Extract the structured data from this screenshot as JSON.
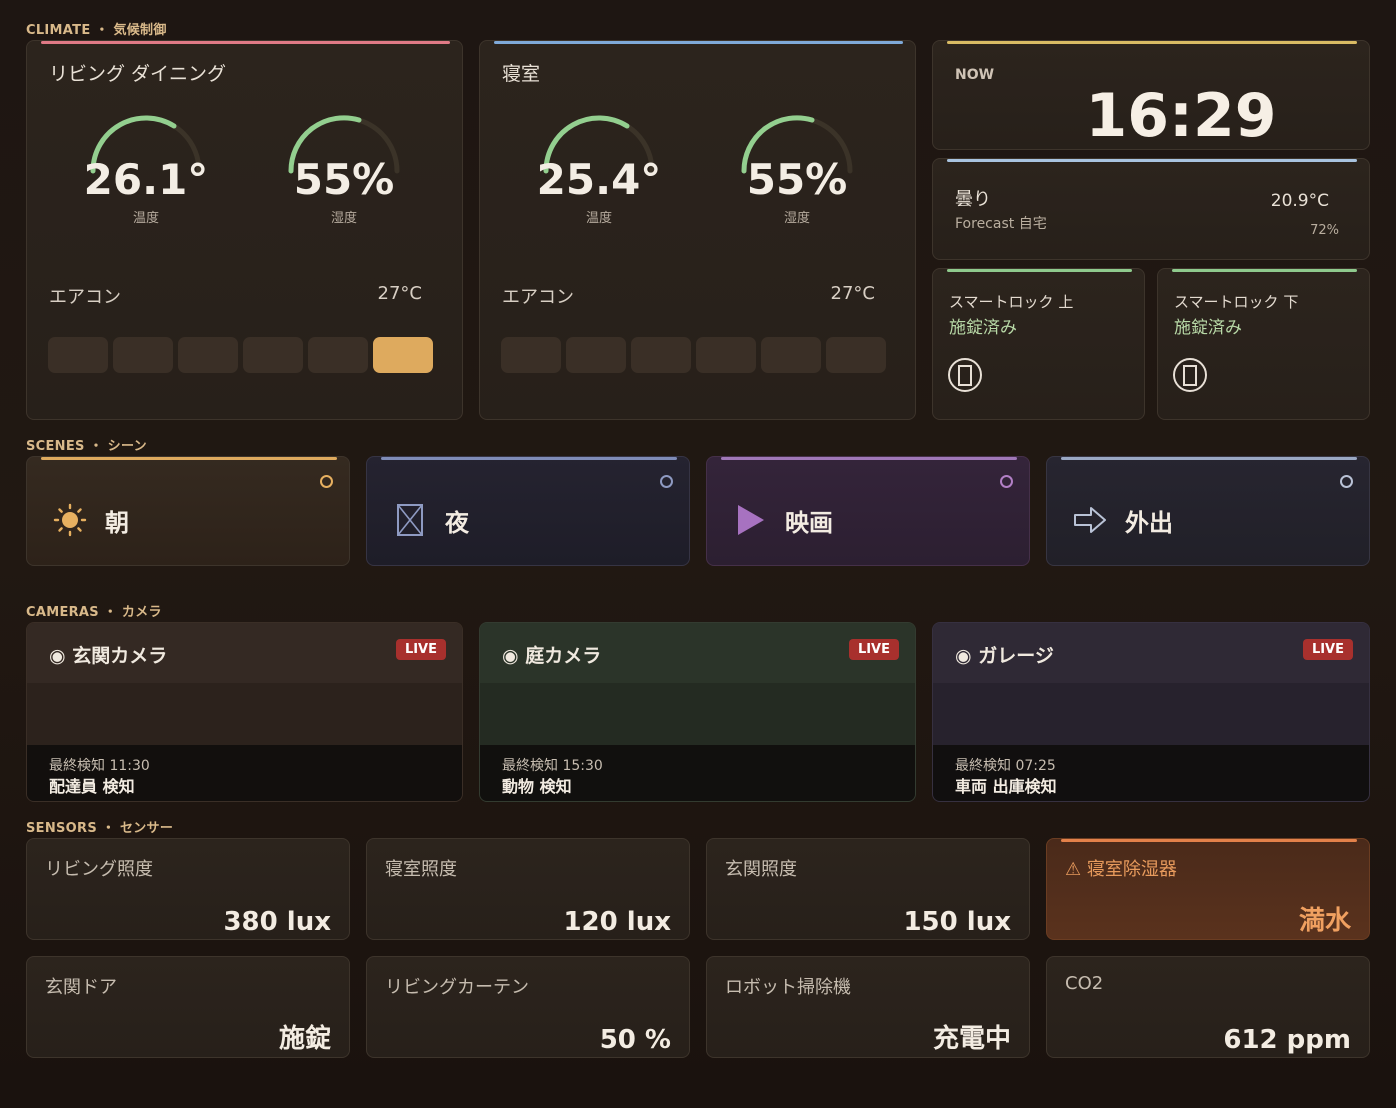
{
  "sections": {
    "climate": "CLIMATE ・ 気候制御",
    "scenes": "SCENES ・ シーン",
    "cameras": "CAMERAS ・ カメラ",
    "sensors": "SENSORS ・ センサー"
  },
  "climate": {
    "rooms": [
      {
        "name": "リビング ダイニング",
        "temperature": {
          "value": "26.1°",
          "label": "温度",
          "level": 0.7
        },
        "humidity": {
          "value": "55%",
          "label": "湿度",
          "level": 0.55
        },
        "ac_label": "エアコン",
        "ac_temp": "27°C",
        "ac_levels": 6,
        "ac_active_index": 5,
        "accent": "#e07a86"
      },
      {
        "name": "寝室",
        "temperature": {
          "value": "25.4°",
          "label": "温度",
          "level": 0.7
        },
        "humidity": {
          "value": "55%",
          "label": "湿度",
          "level": 0.55
        },
        "ac_label": "エアコン",
        "ac_temp": "27°C",
        "ac_levels": 6,
        "ac_active_index": -1,
        "accent": "#7fa9d8"
      }
    ],
    "clock": {
      "label": "NOW",
      "time": "16:29",
      "accent": "#d9bb64"
    },
    "weather": {
      "condition": "曇り",
      "source": "Forecast 自宅",
      "temperature": "20.9°C",
      "humidity": "72%",
      "accent": "#a9c3df"
    },
    "locks": [
      {
        "name": "スマートロック 上",
        "state": "施錠済み",
        "accent": "#8fca8d"
      },
      {
        "name": "スマートロック 下",
        "state": "施錠済み",
        "accent": "#8fca8d"
      }
    ]
  },
  "scenes": [
    {
      "name": "朝",
      "icon": "sun-icon",
      "accent": "#deaa5e",
      "color": "#e7b060"
    },
    {
      "name": "夜",
      "icon": "night-box-icon",
      "accent": "#7f8cb8",
      "color": "#8e9ac2"
    },
    {
      "name": "映画",
      "icon": "play-icon",
      "accent": "#a078b8",
      "color": "#b27fc6"
    },
    {
      "name": "外出",
      "icon": "arrow-right-icon",
      "accent": "#9aa8c4",
      "color": "#b9c2d6"
    }
  ],
  "cameras": [
    {
      "name": "◉ 玄関カメラ",
      "live": "LIVE",
      "last_detect": "最終検知  11:30",
      "event": "配達員 検知"
    },
    {
      "name": "◉ 庭カメラ",
      "live": "LIVE",
      "last_detect": "最終検知  15:30",
      "event": "動物 検知"
    },
    {
      "name": "◉ ガレージ",
      "live": "LIVE",
      "last_detect": "最終検知  07:25",
      "event": "車両 出庫検知"
    }
  ],
  "sensors": [
    {
      "label": "リビング照度",
      "value": "380 lux"
    },
    {
      "label": "寝室照度",
      "value": "120 lux"
    },
    {
      "label": "玄関照度",
      "value": "150 lux"
    },
    {
      "label": "⚠ 寝室除湿器",
      "value": "満水",
      "warning": true,
      "accent": "#e3814a"
    },
    {
      "label": "玄関ドア",
      "value": "施錠"
    },
    {
      "label": "リビングカーテン",
      "value": "50 %"
    },
    {
      "label": "ロボット掃除機",
      "value": "充電中"
    },
    {
      "label": "CO2",
      "value": "612 ppm"
    }
  ]
}
